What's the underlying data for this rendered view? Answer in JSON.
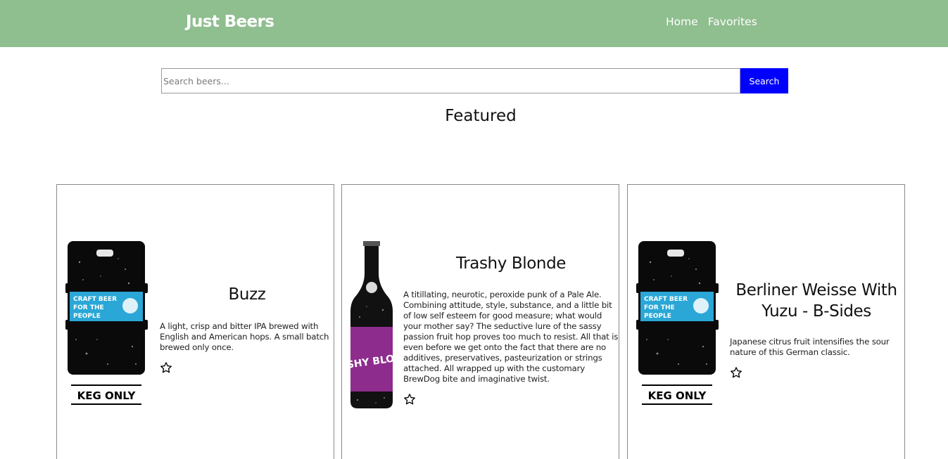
{
  "navbar": {
    "brand": "Just Beers",
    "links": [
      "Home",
      "Favorites"
    ]
  },
  "search": {
    "placeholder": "Search beers...",
    "button_label": "Search"
  },
  "featured": {
    "title": "Featured",
    "beers": [
      {
        "name": "Buzz",
        "description": "A light, crisp and bitter IPA brewed with English and American hops. A small batch brewed only once.",
        "image": "keg-icon",
        "keg_label_lines": [
          "CRAFT BEER",
          "FOR THE",
          "PEOPLE"
        ],
        "keg_footer": "KEG ONLY",
        "favorite": false
      },
      {
        "name": "Trashy Blonde",
        "description": "A titillating, neurotic, peroxide punk of a Pale Ale. Combining attitude, style, substance, and a little bit of low self esteem for good measure; what would your mother say? The seductive lure of the sassy passion fruit hop proves too much to resist. All that is even before we get onto the fact that there are no additives, preservatives, pasteurization or strings attached. All wrapped up with the customary BrewDog bite and imaginative twist.",
        "image": "bottle-icon",
        "bottle_label": "TRASHY BLONDE",
        "favorite": false
      },
      {
        "name": "Berliner Weisse With Yuzu - B-Sides",
        "description": "Japanese citrus fruit intensifies the sour nature of this German classic.",
        "image": "keg-icon",
        "keg_label_lines": [
          "CRAFT BEER",
          "FOR THE",
          "PEOPLE"
        ],
        "keg_footer": "KEG ONLY",
        "favorite": false
      }
    ]
  },
  "colors": {
    "navbar": "#8fbe8f",
    "search_button": "#0000ff",
    "keg_label": "#2aa7d6",
    "bottle_label": "#8e2c8e"
  }
}
